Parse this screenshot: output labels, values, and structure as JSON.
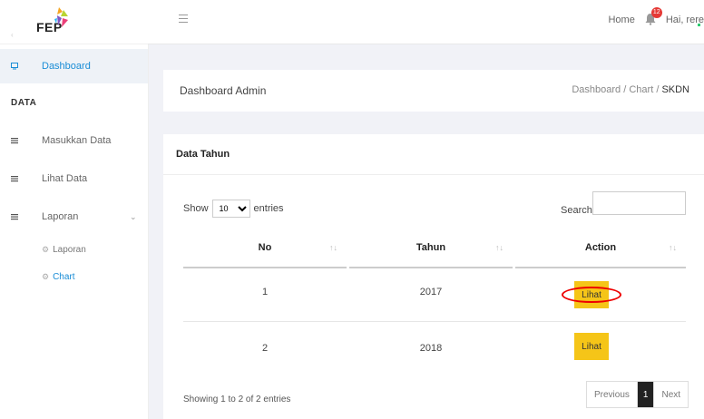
{
  "brand": {
    "logo_text": "FEP"
  },
  "sidebar": {
    "dashboard": "Dashboard",
    "section_data": "DATA",
    "items": [
      {
        "label": "Masukkan Data"
      },
      {
        "label": "Lihat Data"
      },
      {
        "label": "Laporan"
      }
    ],
    "sub_items": [
      {
        "label": "Laporan"
      },
      {
        "label": "Chart"
      }
    ]
  },
  "topbar": {
    "home": "Home",
    "notification_count": "12",
    "greeting": "Hai, rere"
  },
  "header": {
    "title": "Dashboard Admin",
    "breadcrumb": [
      "Dashboard",
      "Chart",
      "SKDN"
    ]
  },
  "card": {
    "title": "Data Tahun",
    "show": "Show",
    "entries_value": "10",
    "entries": "entries",
    "search_label": "Search:",
    "columns": [
      "No",
      "Tahun",
      "Action"
    ],
    "rows": [
      {
        "no": "1",
        "tahun": "2017",
        "action": "Lihat"
      },
      {
        "no": "2",
        "tahun": "2018",
        "action": "Lihat"
      }
    ],
    "info": "Showing 1 to 2 of 2 entries",
    "pagination": {
      "previous": "Previous",
      "current": "1",
      "next": "Next"
    }
  },
  "colors": {
    "accent": "#1a8dd6",
    "button": "#f5c518",
    "highlight": "#e00000"
  }
}
